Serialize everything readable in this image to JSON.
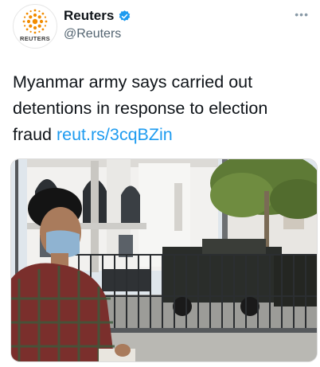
{
  "account": {
    "avatar_wordmark": "REUTERS",
    "display_name": "Reuters",
    "handle": "@Reuters",
    "verified_icon": "verified-badge-icon",
    "more_icon": "more-options-icon"
  },
  "tweet": {
    "text": "Myanmar army says carried out detentions in response to election fraud ",
    "link": "reut.rs/3cqBZin"
  },
  "media": {
    "description_icon": "news-photo"
  },
  "colors": {
    "link": "#1d9bf0",
    "verified": "#1d9bf0",
    "secondary_text": "#536471",
    "brand_orange": "#f28c00"
  }
}
